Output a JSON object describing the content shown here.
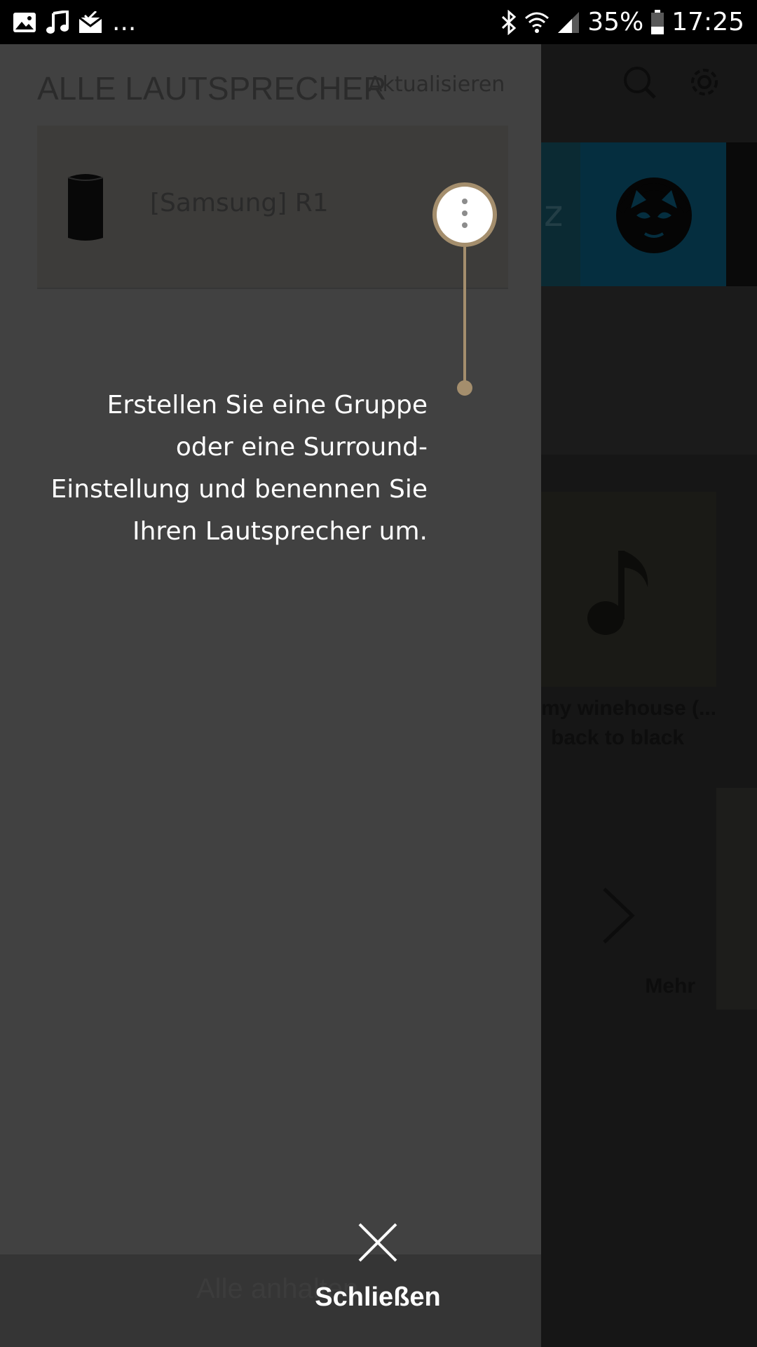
{
  "status_bar": {
    "overflow": "...",
    "battery": "35%",
    "time": "17:25",
    "icons": [
      "image-icon",
      "music-icon",
      "mail-icon",
      "bluetooth-icon",
      "wifi-icon",
      "signal-icon",
      "battery-icon"
    ]
  },
  "drawer": {
    "title": "ALLE LAUTSPRECHER",
    "refresh_label": "Aktualisieren",
    "speakers": [
      {
        "name": "[Samsung] R1"
      }
    ],
    "bottom_label": "Alle anhalten"
  },
  "coach_mark": {
    "hint_lines": [
      "Erstellen Sie eine Gruppe",
      "oder eine Surround-",
      "Einstellung und benennen Sie",
      "Ihren Lautsprecher um."
    ],
    "close_label": "Schließen"
  },
  "background": {
    "tile_letter": "z",
    "album_line_1": "my winehouse (...",
    "album_line_2": "back to black",
    "more_label": "Mehr"
  },
  "colors": {
    "accent": "#a48e6d",
    "drawer_bg": "#414141",
    "bottom_bar": "#353535"
  }
}
